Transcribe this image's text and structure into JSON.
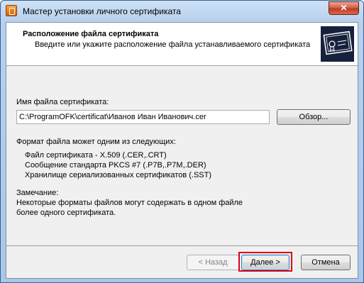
{
  "window": {
    "title": "Мастер установки личного сертификата",
    "close_label": "✕"
  },
  "header": {
    "title": "Расположение файла сертификата",
    "subtitle": "Введите или укажите расположение файла устанавливаемого сертификата",
    "icon": "certificate-icon"
  },
  "form": {
    "file_label": "Имя файла сертификата:",
    "file_value": "C:\\ProgramOFK\\certificat\\Иванов Иван Иванович.cer",
    "browse_label": "Обзор..."
  },
  "formats": {
    "intro": "Формат файла может одним из следующих:",
    "items": [
      "Файл сертификата - X.509 (.CER,.CRT)",
      "Сообщение стандарта PKCS #7 (.P7B,.P7M,.DER)",
      "Хранилище сериализованных сертификатов (.SST)"
    ]
  },
  "note": {
    "title": "Замечание:",
    "line1": "Некоторые форматы файлов могут содержать в одном файле",
    "line2": "более одного сертификата."
  },
  "buttons": {
    "back": "< Назад",
    "next": "Далее >",
    "cancel": "Отмена"
  },
  "colors": {
    "highlight": "#e0001a",
    "icon_bg": "#16213d"
  }
}
